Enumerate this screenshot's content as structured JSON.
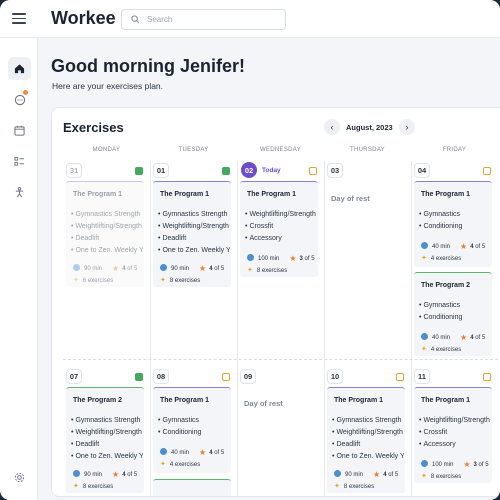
{
  "app": {
    "name": "Workee"
  },
  "search": {
    "placeholder": "Search"
  },
  "sidebar": {
    "items": [
      {
        "icon": "home-icon",
        "active": true
      },
      {
        "icon": "chat-icon",
        "badge": true
      },
      {
        "icon": "calendar-icon"
      },
      {
        "icon": "checklist-icon"
      },
      {
        "icon": "exercise-icon"
      },
      {
        "icon": "settings-icon"
      }
    ]
  },
  "greeting": {
    "title": "Good morning Jenifer!",
    "subtitle": "Here are your exercises plan."
  },
  "exercises": {
    "title": "Exercises",
    "month": "August, 2023",
    "today_label": "Today",
    "days": [
      "MONDAY",
      "TUESDAY",
      "WEDNESDAY",
      "THURSDAY",
      "FRIDAY"
    ],
    "rest_label": "Day of rest",
    "week1": {
      "dates": [
        "31",
        "01",
        "02",
        "03",
        "04"
      ],
      "cards": {
        "mon": {
          "title": "The Program 1",
          "items": [
            "Gymnastics Strength",
            "Weightlifting/Strength",
            "Deadlift",
            "One to Zen. Weekly Yoga"
          ],
          "duration": "90 min",
          "rating": "4",
          "rating_of": "of 5",
          "count": "6 exercises"
        },
        "tue": {
          "title": "The Program 1",
          "items": [
            "Gymnastics Strength",
            "Weightlifting/Strength",
            "Deadlift",
            "One to Zen. Weekly Yoga"
          ],
          "duration": "90 min",
          "rating": "4",
          "rating_of": "of 5",
          "count": "8 exercises"
        },
        "wed": {
          "title": "The Program 1",
          "items": [
            "Weightlifting/Strength",
            "Crossfit",
            "Accessory"
          ],
          "duration": "100 min",
          "rating": "3",
          "rating_of": "of 5",
          "count": "8 exercises"
        },
        "fri1": {
          "title": "The Program 1",
          "items": [
            "Gymnastics",
            "Conditioning"
          ],
          "duration": "40 min",
          "rating": "4",
          "rating_of": "of 5",
          "count": "4 exercises"
        },
        "fri2": {
          "title": "The Program 2",
          "items": [
            "Gymnastics",
            "Conditioning"
          ],
          "duration": "40 min",
          "rating": "4",
          "rating_of": "of 5",
          "count": "4 exercises"
        }
      }
    },
    "week2": {
      "dates": [
        "07",
        "08",
        "09",
        "10",
        "11"
      ],
      "cards": {
        "mon": {
          "title": "The Program 2",
          "items": [
            "Gymnastics Strength",
            "Weightlifting/Strength",
            "Deadlift",
            "One to Zen. Weekly Yoga"
          ],
          "duration": "90 min",
          "rating": "4",
          "rating_of": "of 5",
          "count": "8 exercises"
        },
        "tue": {
          "title": "The Program 1",
          "items": [
            "Gymnastics",
            "Conditioning"
          ],
          "duration": "40 min",
          "rating": "4",
          "rating_of": "of 5",
          "count": "4 exercises"
        },
        "thu": {
          "title": "The Program 1",
          "items": [
            "Gymnastics Strength",
            "Weightlifting/Strength",
            "Deadlift",
            "One to Zen. Weekly Yoga"
          ],
          "duration": "90 min",
          "rating": "4",
          "rating_of": "of 5",
          "count": "8 exercises"
        },
        "fri": {
          "title": "The Program 1",
          "items": [
            "Weightlifting/Strength",
            "Crossfit",
            "Accessory"
          ],
          "duration": "100 min",
          "rating": "3",
          "rating_of": "of 5",
          "count": "8 exercises"
        }
      }
    }
  },
  "colors": {
    "accent": "#6c4ccf",
    "done": "#45a85e",
    "planned": "#e0a431",
    "star": "#ee7d2a",
    "duration": "#4a8fd0"
  }
}
